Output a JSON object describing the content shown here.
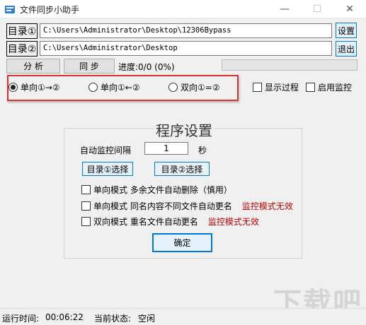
{
  "window": {
    "title": "文件同步小助手",
    "minimize_glyph": "—",
    "maximize_glyph": "☐",
    "close_glyph": "✕"
  },
  "dir1": {
    "label": "目录①",
    "path": "C:\\Users\\Administrator\\Desktop\\12306Bypass"
  },
  "dir2": {
    "label": "目录②",
    "path": "C:\\Users\\Administrator\\Desktop"
  },
  "buttons": {
    "settings": "设置",
    "exit": "退出",
    "analyze": "分 析",
    "sync": "同 步",
    "confirm": "确定",
    "select_dir1": "目录①选择",
    "select_dir2": "目录②选择"
  },
  "progress": {
    "text": "进度:0/0 (0%)",
    "value": 0
  },
  "modes": {
    "one_way_1_to_2": "单向①→②",
    "one_way_2_to_1": "单向①←②",
    "two_way": "双向①=②",
    "selected": "one_way_1_to_2"
  },
  "toggles": {
    "show_process": "显示过程",
    "enable_monitor": "启用监控"
  },
  "settings_panel": {
    "title": "程序设置",
    "interval_label": "自动监控间隔",
    "interval_value": "1",
    "interval_unit": "秒",
    "opt1_label": "单向模式  多余文件自动删除（慎用）",
    "opt2_label": "单向模式  同名内容不同文件自动更名",
    "opt2_warn": "监控模式无效",
    "opt3_label": "双向模式  重名文件自动更名",
    "opt3_warn": "监控模式无效"
  },
  "status": {
    "runtime_label": "运行时间:",
    "runtime_value": "00:06:22",
    "state_label": "当前状态:",
    "state_value": "空闲"
  },
  "watermark": {
    "text": "下载吧"
  },
  "colors": {
    "highlight_border": "#d9342b",
    "warn_text": "#c00000",
    "focus_border": "#0078d7"
  }
}
